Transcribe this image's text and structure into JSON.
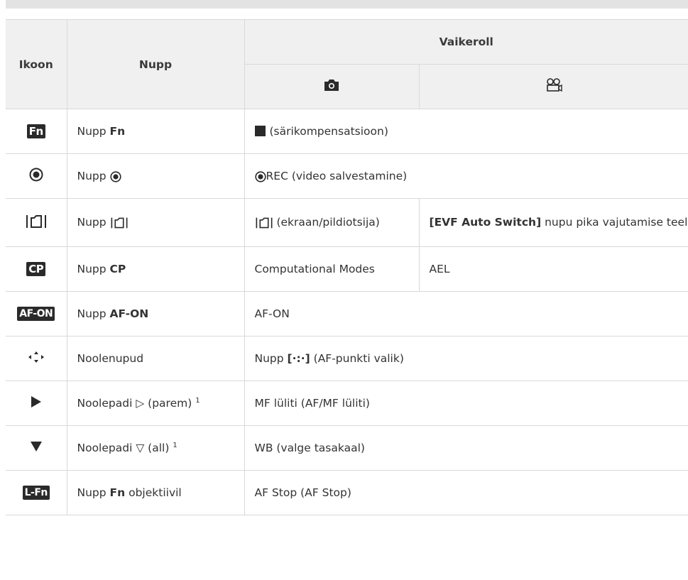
{
  "header": {
    "icon_col": "Ikoon",
    "button_col": "Nupp",
    "default_role": "Vaikeroll",
    "photo_icon": "camera-icon",
    "video_icon": "movie-camera-icon"
  },
  "rows": [
    {
      "icon_label": "Fn",
      "button_prefix": "Nupp",
      "button_bold": "Fn",
      "role": "(särikompensatsioon)"
    },
    {
      "button_prefix": "Nupp",
      "role": "REC (video salvestamine)"
    },
    {
      "button_prefix": "Nupp",
      "role_photo": "(ekraan/pildiotsija)",
      "role_video_bold": "[EVF Auto Switch]",
      "role_video": "nupu pika vajutamise teel"
    },
    {
      "icon_label": "CP",
      "button_prefix": "Nupp",
      "button_bold": "CP",
      "role_photo": "Computational Modes",
      "role_video": "AEL"
    },
    {
      "icon_label": "AF-ON",
      "button_prefix": "Nupp",
      "button_bold": "AF-ON",
      "role": "AF-ON"
    },
    {
      "button": "Noolenupud",
      "role_prefix": "Nupp",
      "role_bold": "[·:·]",
      "role": "(AF-punkti valik)"
    },
    {
      "button": "Noolepadi ▷ (parem)",
      "footnote": "1",
      "role": "MF lüliti (AF/MF lüliti)"
    },
    {
      "button": "Noolepadi ▽ (all)",
      "footnote": "1",
      "role": "WB (valge tasakaal)"
    },
    {
      "icon_label": "L-Fn",
      "button_prefix": "Nupp",
      "button_bold": "Fn",
      "button_suffix": "objektiivil",
      "role": "AF Stop (AF Stop)"
    }
  ]
}
